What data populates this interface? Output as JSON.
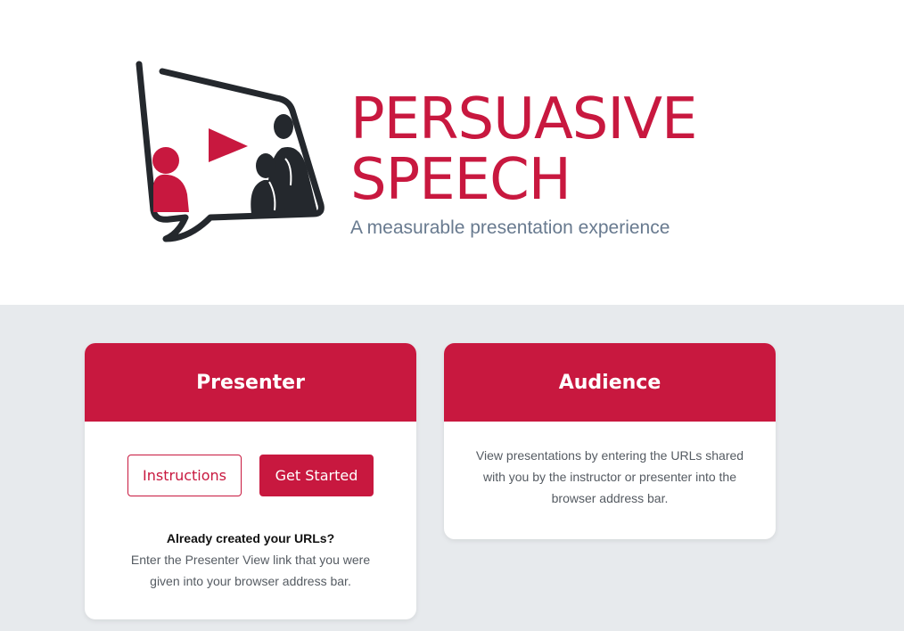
{
  "brand": {
    "title_line1": "PERSUASIVE",
    "title_line2": "SPEECH",
    "tagline": "A measurable presentation experience",
    "primary_color": "#c8183f",
    "dark_color": "#24282d"
  },
  "presenter": {
    "heading": "Presenter",
    "instructions_label": "Instructions",
    "get_started_label": "Get Started",
    "note_title": "Already created your URLs?",
    "note_line1": "Enter the Presenter View link that you were",
    "note_line2": "given into your browser address bar."
  },
  "audience": {
    "heading": "Audience",
    "line1": "View presentations by entering the URLs shared",
    "line2": "with you by the instructor or presenter into the",
    "line3": "browser address bar."
  }
}
